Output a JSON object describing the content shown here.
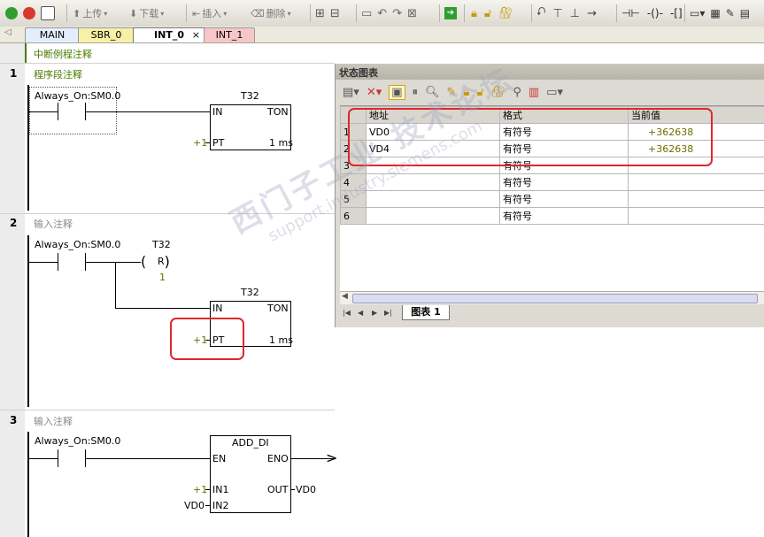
{
  "toolbar": {
    "upload_label": "上传",
    "download_label": "下载",
    "insert_label": "插入",
    "delete_label": "删除"
  },
  "tabs": [
    {
      "label": "MAIN"
    },
    {
      "label": "SBR_0"
    },
    {
      "label": "INT_0",
      "close": "×"
    },
    {
      "label": "INT_1"
    }
  ],
  "tab_nav_icon": "◁",
  "editor": {
    "title_comment": "中断例程注释",
    "networks": [
      {
        "number": "1",
        "comment": "程序段注释",
        "contact": "Always_On:SM0.0",
        "box": {
          "name": "T32",
          "in": "IN",
          "type": "TON",
          "pt_value": "+1",
          "pt": "PT",
          "base": "1 ms"
        }
      },
      {
        "number": "2",
        "comment": "输入注释",
        "contact": "Always_On:SM0.0",
        "coil": {
          "name": "T32",
          "type": "R",
          "count": "1"
        },
        "box": {
          "name": "T32",
          "in": "IN",
          "type": "TON",
          "pt_value": "+1",
          "pt": "PT",
          "base": "1 ms"
        }
      },
      {
        "number": "3",
        "comment": "输入注释",
        "contact": "Always_On:SM0.0",
        "box": {
          "name": "ADD_DI",
          "en": "EN",
          "eno": "ENO",
          "in1_value": "+1",
          "in1": "IN1",
          "out": "OUT",
          "out_value": "VD0",
          "in2_value": "VD0",
          "in2": "IN2"
        }
      }
    ]
  },
  "status_chart": {
    "title": "状态图表",
    "columns": [
      "地址",
      "格式",
      "当前值"
    ],
    "rows": [
      {
        "num": "1",
        "address": "VD0",
        "format": "有符号",
        "value": "+362638"
      },
      {
        "num": "2",
        "address": "VD4",
        "format": "有符号",
        "value": "+362638"
      },
      {
        "num": "3",
        "address": "",
        "format": "有符号",
        "value": ""
      },
      {
        "num": "4",
        "address": "",
        "format": "有符号",
        "value": ""
      },
      {
        "num": "5",
        "address": "",
        "format": "有符号",
        "value": ""
      },
      {
        "num": "6",
        "address": "",
        "format": "有符号",
        "value": ""
      }
    ],
    "sheet_tab": "图表 1",
    "nav_first": "|◀",
    "nav_prev": "◀",
    "nav_next": "▶",
    "nav_last": "▶|"
  },
  "watermark": {
    "line1": "西门子工业 技术论坛",
    "line2": "support.industry.siemens.com"
  },
  "colors": {
    "highlight": "#e0262e",
    "value_text": "#6e6e00",
    "comment_green": "#4c7a00"
  }
}
